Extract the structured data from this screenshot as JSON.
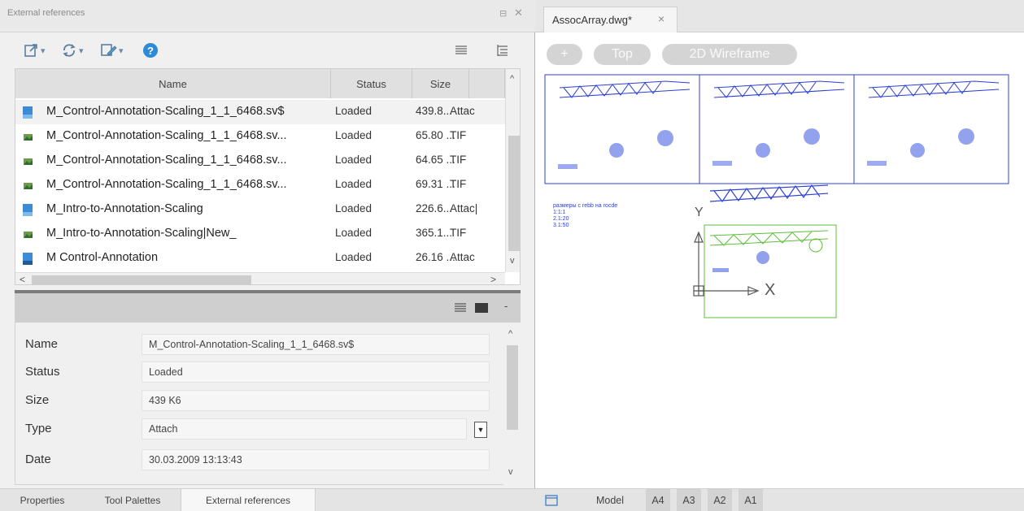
{
  "palette": {
    "title": "External references",
    "pin_glyph": "⊟",
    "close_glyph": "✕",
    "toolbar": {
      "attach_icon": "attach-icon",
      "refresh_icon": "refresh-icon",
      "change_path_icon": "change-path-icon",
      "help_icon": "help-icon",
      "list_view_icon": "list-view-icon",
      "tree_view_icon": "tree-view-icon",
      "dropdown_glyph": "▾",
      "help_glyph": "?"
    },
    "list": {
      "columns": [
        "Name",
        "Status",
        "Size",
        ""
      ],
      "rows": [
        {
          "icon": "dwg",
          "name": "M_Control-Annotation-Scaling_1_1_6468.sv$",
          "status": "Loaded",
          "size": "439.8...",
          "type": "Attac",
          "selected": true
        },
        {
          "icon": "img",
          "name": "M_Control-Annotation-Scaling_1_1_6468.sv...",
          "status": "Loaded",
          "size": "65.80 ...",
          "type": "TIF",
          "selected": false
        },
        {
          "icon": "img",
          "name": "M_Control-Annotation-Scaling_1_1_6468.sv...",
          "status": "Loaded",
          "size": "64.65 ...",
          "type": "TIF",
          "selected": false
        },
        {
          "icon": "img",
          "name": "M_Control-Annotation-Scaling_1_1_6468.sv...",
          "status": "Loaded",
          "size": "69.31 ...",
          "type": "TIF",
          "selected": false
        },
        {
          "icon": "dwg",
          "name": "M_Intro-to-Annotation-Scaling",
          "status": "Loaded",
          "size": "226.6...",
          "type": "Attac|",
          "selected": false
        },
        {
          "icon": "img",
          "name": "M_Intro-to-Annotation-Scaling|New_",
          "status": "Loaded",
          "size": "365.1...",
          "type": "TIF",
          "selected": false
        },
        {
          "icon": "pdf",
          "name": "M Control-Annotation",
          "status": "Loaded",
          "size": "26.16 ...",
          "type": "Attac",
          "selected": false
        }
      ],
      "scroll_up": "^",
      "scroll_down": "v",
      "scroll_left": "<",
      "scroll_right": ">"
    },
    "details": {
      "menu_glyph": "-",
      "fields": [
        {
          "label": "Name",
          "value": "M_Control-Annotation-Scaling_1_1_6468.sv$"
        },
        {
          "label": "Status",
          "value": "Loaded"
        },
        {
          "label": "Size",
          "value": "439 K6"
        },
        {
          "label": "Type",
          "value": "Attach"
        },
        {
          "label": "Date",
          "value": "30.03.2009 13:13:43"
        }
      ],
      "type_dropdown_glyph": "▼",
      "scroll_up": "^",
      "scroll_down": "v"
    },
    "tabs": [
      "Properties",
      "Tool Palettes",
      "External references"
    ],
    "active_tab": "External references"
  },
  "drawing": {
    "tab_title": "AssocArray.dwg*",
    "tab_close": "×",
    "viewport_controls": [
      "+",
      "Top",
      "2D Wireframe"
    ],
    "annotation_lines": [
      "размеры с rebb на rocde",
      "1:1:1",
      "2.1:20",
      "3.1:50"
    ],
    "axis_y": "Y",
    "axis_x": "X",
    "layout_tabs": [
      "Model",
      "A4",
      "A3",
      "A2",
      "A1"
    ],
    "active_layout": "Model",
    "colors": {
      "drawing_blue": "#2b3fd6",
      "drawing_green": "#5fbf3a"
    }
  }
}
